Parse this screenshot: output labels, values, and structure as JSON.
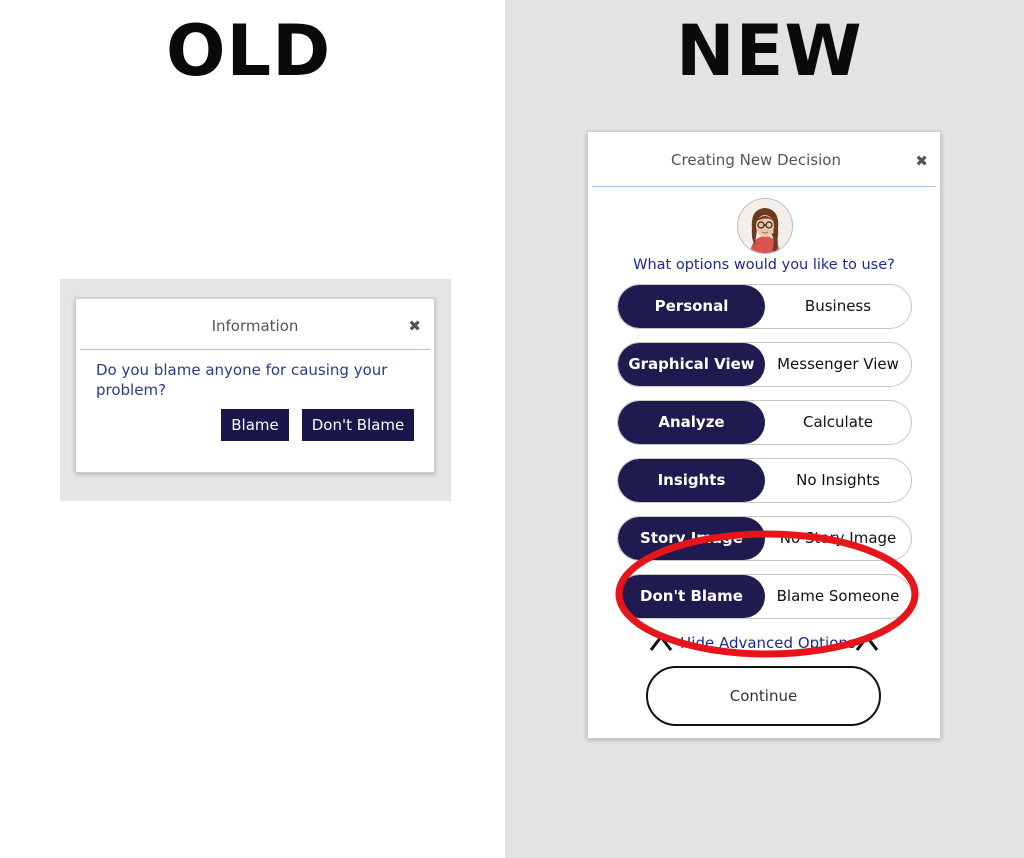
{
  "headings": {
    "old": "OLD",
    "new": "NEW"
  },
  "colors": {
    "accent": "#1f1a4f",
    "link": "#1b2b8c",
    "highlight": "#e8141c"
  },
  "old_dialog": {
    "title": "Information",
    "close_icon": "close-icon",
    "message": "Do you blame anyone for causing your problem?",
    "buttons": {
      "blame": "Blame",
      "dont_blame": "Don't Blame"
    }
  },
  "new_dialog": {
    "title": "Creating New Decision",
    "close_icon": "close-icon",
    "question": "What options would you like to use?",
    "toggles": [
      {
        "left": "Personal",
        "right": "Business"
      },
      {
        "left": "Graphical View",
        "right": "Messenger View"
      },
      {
        "left": "Analyze",
        "right": "Calculate"
      },
      {
        "left": "Insights",
        "right": "No Insights"
      },
      {
        "left": "Story Image",
        "right": "No Story Image"
      },
      {
        "left": "Don't Blame",
        "right": "Blame Someone"
      }
    ],
    "selected": "left",
    "advanced_link": "Hide Advanced Options",
    "continue": "Continue"
  }
}
